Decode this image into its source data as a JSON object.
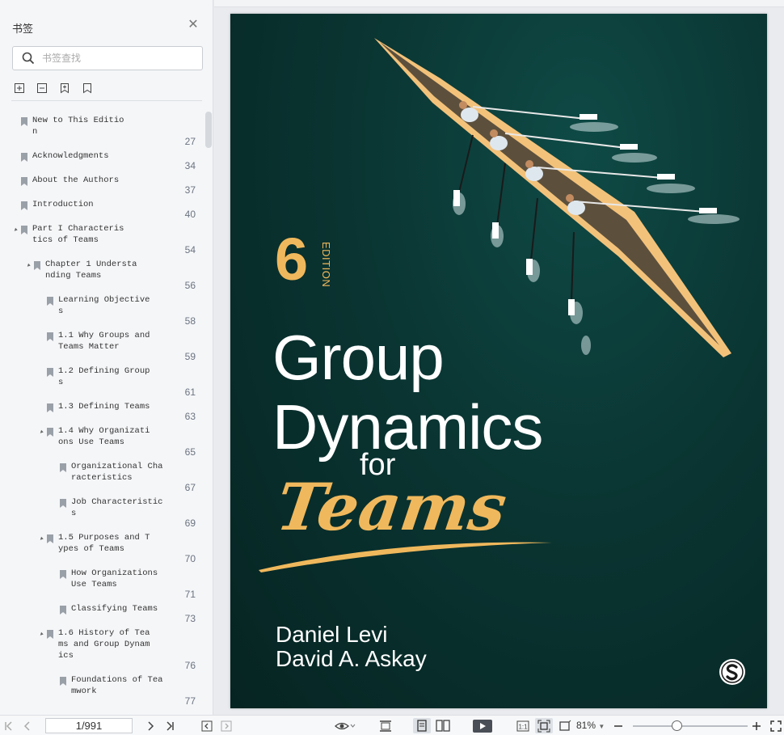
{
  "sidebar": {
    "title": "书签",
    "close_icon": "close-icon",
    "search_placeholder": "书签查找",
    "tools": [
      "expand-all-icon",
      "collapse-all-icon",
      "add-bookmark-icon",
      "bookmark-icon"
    ],
    "bookmarks": [
      {
        "label": "New to This Edition",
        "page": "27",
        "level": 0,
        "arrow": ""
      },
      {
        "label": "Acknowledgments",
        "page": "34",
        "level": 0,
        "arrow": ""
      },
      {
        "label": "About the Authors",
        "page": "37",
        "level": 0,
        "arrow": ""
      },
      {
        "label": "Introduction",
        "page": "40",
        "level": 0,
        "arrow": ""
      },
      {
        "label": "Part I Characteristics of Teams",
        "page": "54",
        "level": 0,
        "arrow": "▲"
      },
      {
        "label": "Chapter 1 Understanding Teams",
        "page": "56",
        "level": 1,
        "arrow": "▲"
      },
      {
        "label": "Learning Objectives",
        "page": "58",
        "level": 2,
        "arrow": ""
      },
      {
        "label": "1.1 Why Groups and Teams Matter",
        "page": "59",
        "level": 2,
        "arrow": ""
      },
      {
        "label": "1.2 Defining Groups",
        "page": "61",
        "level": 2,
        "arrow": ""
      },
      {
        "label": "1.3 Defining Teams",
        "page": "63",
        "level": 2,
        "arrow": ""
      },
      {
        "label": "1.4 Why Organizations Use Teams",
        "page": "65",
        "level": 2,
        "arrow": "▲"
      },
      {
        "label": "Organizational Characteristics",
        "page": "67",
        "level": 3,
        "arrow": ""
      },
      {
        "label": "Job Characteristics",
        "page": "69",
        "level": 3,
        "arrow": ""
      },
      {
        "label": "1.5 Purposes and Types of Teams",
        "page": "70",
        "level": 2,
        "arrow": "▲"
      },
      {
        "label": "How Organizations Use Teams",
        "page": "71",
        "level": 3,
        "arrow": ""
      },
      {
        "label": "Classifying Teams",
        "page": "73",
        "level": 3,
        "arrow": ""
      },
      {
        "label": "1.6 History of Teams and Group Dynamics",
        "page": "76",
        "level": 2,
        "arrow": "▲"
      },
      {
        "label": "Foundations of Teamwork",
        "page": "77",
        "level": 3,
        "arrow": ""
      }
    ]
  },
  "cover": {
    "edition_number": "6",
    "edition_label": "EDITION",
    "title_line1": "Group",
    "title_line2": "Dynamics",
    "title_for": "for",
    "title_teams": "Teams",
    "author1": "Daniel Levi",
    "author2": "David A. Askay",
    "publisher_logo": "sage-logo"
  },
  "toolbar": {
    "page_value": "1/991",
    "zoom": "81%",
    "zoom_level_fraction": 0.38
  }
}
